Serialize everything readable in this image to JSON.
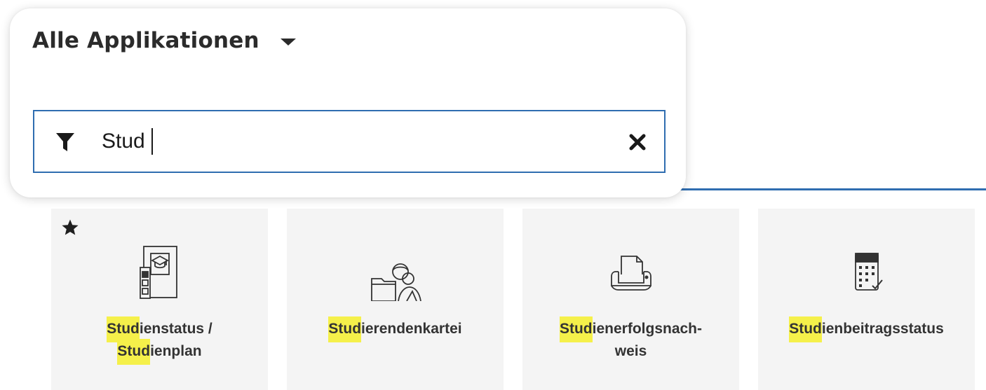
{
  "popup": {
    "title": "Alle Applikationen",
    "filter": {
      "value": "Stud",
      "placeholder": ""
    }
  },
  "colors": {
    "accent": "#2f6db0",
    "highlight": "#f5f04a",
    "tile_background": "#f4f4f4",
    "text": "#333333"
  },
  "tiles": [
    {
      "favorite": true,
      "icon": "study-plan-document-icon",
      "lines": [
        {
          "match": "Stud",
          "rest": "ienstatus /"
        },
        {
          "match": "Stud",
          "rest": "ienplan"
        }
      ]
    },
    {
      "favorite": false,
      "icon": "student-folder-icon",
      "lines": [
        {
          "match": "Stud",
          "rest": "ierendenkartei"
        }
      ]
    },
    {
      "favorite": false,
      "icon": "printer-icon",
      "lines": [
        {
          "match": "Stud",
          "rest": "ienerfolgsnach-"
        },
        {
          "match": "",
          "rest": "weis"
        }
      ]
    },
    {
      "favorite": false,
      "icon": "calculator-check-icon",
      "lines": [
        {
          "match": "Stud",
          "rest": "ienbeitragsstatus"
        }
      ]
    }
  ]
}
